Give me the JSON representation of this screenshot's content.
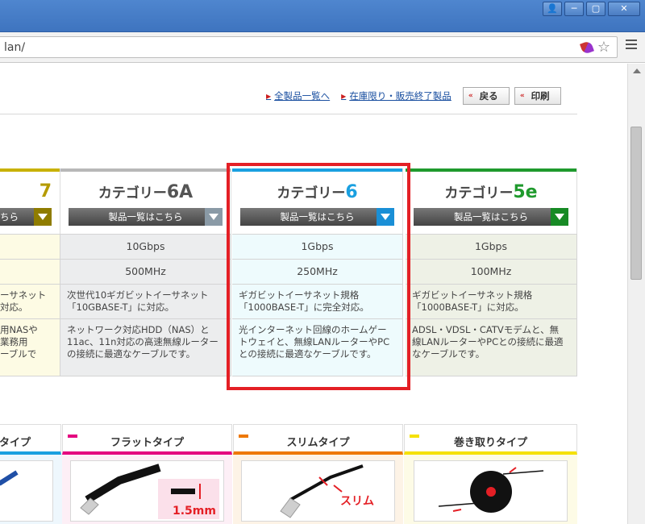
{
  "window": {
    "btn_user": "👤",
    "btn_min": "─",
    "btn_max": "▢",
    "btn_close": "✕"
  },
  "toolbar": {
    "url": "lan/"
  },
  "links": {
    "all_products": "全製品一覧へ",
    "discontinued": "在庫限り・販売終了製品",
    "back": "戻る",
    "print": "印刷"
  },
  "categories": [
    {
      "key": "cut",
      "name_prefix": "",
      "name_num": "7",
      "num_color": "#b59b00",
      "list_btn": "ちら",
      "bar_color": "#c8b100",
      "tri_color": "#8f7c00",
      "speed": "",
      "freq": "",
      "desc": "ーサネット\n対応。",
      "use": "用NASや\n業務用\nーブルで"
    },
    {
      "key": "6a",
      "name_prefix": "カテゴリー",
      "name_num": "6A",
      "num_color": "#555555",
      "list_btn": "製品一覧はこちら",
      "bar_color": "#b8b8b8",
      "tri_color": "#8a9aa6",
      "speed": "10Gbps",
      "freq": "500MHz",
      "desc": "次世代10ギガビットイーサネット\n「10GBASE-T」に対応。",
      "use": "ネットワーク対応HDD（NAS）と\n11ac、11n対応の高速無線ルーター\nの接続に最適なケーブルです。"
    },
    {
      "key": "6",
      "name_prefix": "カテゴリー",
      "name_num": "6",
      "num_color": "#1aa0e0",
      "list_btn": "製品一覧はこちら",
      "bar_color": "#1aa0e0",
      "tri_color": "#1a8fd6",
      "speed": "1Gbps",
      "freq": "250MHz",
      "desc": "ギガビットイーサネット規格\n「1000BASE-T」に完全対応。",
      "use": "光インターネット回線のホームゲー\nトウェイと、無線LANルーターやPC\nとの接続に最適なケーブルです。"
    },
    {
      "key": "5e",
      "name_prefix": "カテゴリー",
      "name_num": "5e",
      "num_color": "#1f9a2d",
      "list_btn": "製品一覧はこちら",
      "bar_color": "#1f9a2d",
      "tri_color": "#178a25",
      "speed": "1Gbps",
      "freq": "100MHz",
      "desc": "ギガビットイーサネット規格\n「1000BASE-T」に対応。",
      "use": "ADSL・VDSL・CATVモデムと、無\n線LANルーターやPCとの接続に最適\nなケーブルです。"
    }
  ],
  "types": [
    {
      "label": "タイプ",
      "mark": "",
      "color": "#1aa0e0"
    },
    {
      "label": "フラットタイプ",
      "mark": "■",
      "color": "#e4007f",
      "dim": "1.5mm"
    },
    {
      "label": "スリムタイプ",
      "mark": "■",
      "color": "#ee7800",
      "slim": "スリム"
    },
    {
      "label": "巻き取りタイプ",
      "mark": "■",
      "color": "#f5e100"
    }
  ],
  "colors": {
    "highlight": "#e41f25"
  }
}
